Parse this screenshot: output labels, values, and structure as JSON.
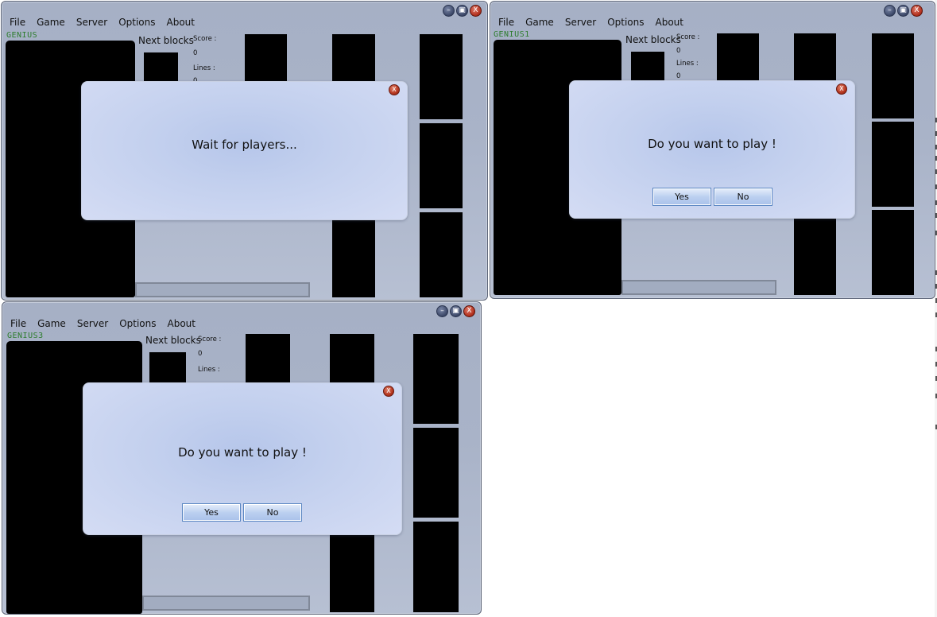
{
  "menu": [
    "File",
    "Game",
    "Server",
    "Options",
    "About"
  ],
  "window_controls": {
    "minimize": "–",
    "maximize": "▣",
    "close": "X"
  },
  "labels": {
    "next_blocks": "Next blocks",
    "score": "Score :",
    "lines": "Lines :"
  },
  "windows": [
    {
      "player": "GENIUS",
      "score": "0",
      "lines": "0",
      "dialog": {
        "message": "Wait for players..."
      }
    },
    {
      "player": "GENIUS1",
      "score": "0",
      "lines": "0",
      "dialog": {
        "message": "Do you want to play !",
        "yes": "Yes",
        "no": "No"
      }
    },
    {
      "player": "GENIUS3",
      "score": "0",
      "dialog": {
        "message": "Do you want to play !",
        "yes": "Yes",
        "no": "No"
      }
    }
  ],
  "colors": {
    "player_name": "#2e7d2e",
    "window_bg": "#a9b3c8",
    "dialog_bg": "#c3d0ee"
  }
}
